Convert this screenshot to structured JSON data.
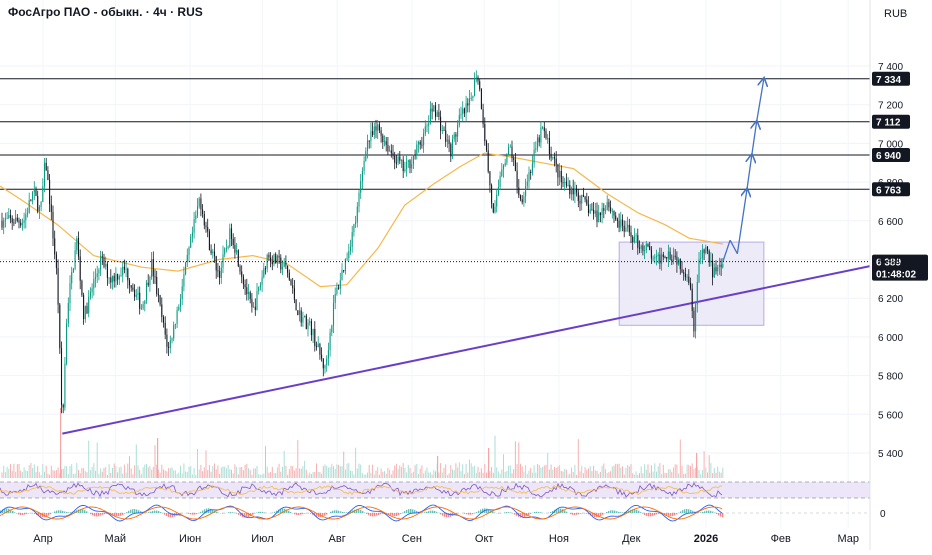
{
  "chart_data": {
    "type": "candlestick",
    "title": "ФосАгро ПАО - обыкн. · 4ч · RUS",
    "currency": "RUB",
    "y_ticks": [
      5400,
      5600,
      5800,
      6000,
      6200,
      6400,
      6600,
      6800,
      7000,
      7200,
      7400
    ],
    "ylim": [
      5260,
      7530
    ],
    "x_labels": [
      "Апр",
      "Май",
      "Июн",
      "Июл",
      "Авг",
      "Сен",
      "Окт",
      "Ноя",
      "Дек",
      "2026",
      "Фев",
      "Мар"
    ],
    "horizontal_levels": [
      {
        "value": 7334,
        "label": "7 334"
      },
      {
        "value": 7112,
        "label": "7 112"
      },
      {
        "value": 6940,
        "label": "6 940"
      },
      {
        "value": 6763,
        "label": "6 763"
      }
    ],
    "current_price": {
      "value": 6389,
      "label": "6 389",
      "countdown": "01:48:02"
    },
    "price_path": [
      [
        "2025-03-24",
        6600
      ],
      [
        "2025-03-28",
        6750
      ],
      [
        "2025-03-31",
        6640
      ],
      [
        "2025-04-02",
        6920
      ],
      [
        "2025-04-04",
        6680
      ],
      [
        "2025-04-07",
        6280
      ],
      [
        "2025-04-09",
        5520
      ],
      [
        "2025-04-11",
        6150
      ],
      [
        "2025-04-15",
        6500
      ],
      [
        "2025-04-18",
        6100
      ],
      [
        "2025-04-22",
        6280
      ],
      [
        "2025-04-25",
        6400
      ],
      [
        "2025-04-29",
        6300
      ],
      [
        "2025-05-05",
        6350
      ],
      [
        "2025-05-12",
        6150
      ],
      [
        "2025-05-16",
        6380
      ],
      [
        "2025-05-21",
        6050
      ],
      [
        "2025-05-23",
        5930
      ],
      [
        "2025-05-27",
        6150
      ],
      [
        "2025-06-01",
        6470
      ],
      [
        "2025-06-05",
        6720
      ],
      [
        "2025-06-09",
        6480
      ],
      [
        "2025-06-13",
        6320
      ],
      [
        "2025-06-18",
        6550
      ],
      [
        "2025-06-23",
        6300
      ],
      [
        "2025-06-27",
        6120
      ],
      [
        "2025-07-03",
        6420
      ],
      [
        "2025-07-08",
        6380
      ],
      [
        "2025-07-11",
        6350
      ],
      [
        "2025-07-16",
        6120
      ],
      [
        "2025-07-21",
        6050
      ],
      [
        "2025-07-25",
        5900
      ],
      [
        "2025-07-27",
        5830
      ],
      [
        "2025-07-31",
        6200
      ],
      [
        "2025-08-05",
        6420
      ],
      [
        "2025-08-09",
        6620
      ],
      [
        "2025-08-13",
        7000
      ],
      [
        "2025-08-18",
        7080
      ],
      [
        "2025-08-23",
        6960
      ],
      [
        "2025-08-29",
        6860
      ],
      [
        "2025-09-02",
        6940
      ],
      [
        "2025-09-06",
        7040
      ],
      [
        "2025-09-10",
        7200
      ],
      [
        "2025-09-14",
        7060
      ],
      [
        "2025-09-17",
        6960
      ],
      [
        "2025-09-21",
        7130
      ],
      [
        "2025-09-25",
        7200
      ],
      [
        "2025-09-28",
        7380
      ],
      [
        "2025-09-30",
        7190
      ],
      [
        "2025-10-03",
        6820
      ],
      [
        "2025-10-05",
        6600
      ],
      [
        "2025-10-08",
        6880
      ],
      [
        "2025-10-12",
        6980
      ],
      [
        "2025-10-16",
        6700
      ],
      [
        "2025-10-20",
        6860
      ],
      [
        "2025-10-25",
        7080
      ],
      [
        "2025-10-29",
        6940
      ],
      [
        "2025-11-02",
        6800
      ],
      [
        "2025-11-07",
        6760
      ],
      [
        "2025-11-12",
        6680
      ],
      [
        "2025-11-17",
        6620
      ],
      [
        "2025-11-21",
        6700
      ],
      [
        "2025-11-26",
        6580
      ],
      [
        "2025-12-01",
        6530
      ],
      [
        "2025-12-04",
        6480
      ],
      [
        "2025-12-08",
        6450
      ],
      [
        "2025-12-11",
        6380
      ],
      [
        "2025-12-15",
        6440
      ],
      [
        "2025-12-19",
        6420
      ],
      [
        "2025-12-23",
        6350
      ],
      [
        "2025-12-25",
        6300
      ],
      [
        "2025-12-27",
        6060
      ],
      [
        "2025-12-29",
        6380
      ],
      [
        "2026-01-01",
        6460
      ],
      [
        "2026-01-04",
        6320
      ],
      [
        "2026-01-06",
        6400
      ],
      [
        "2026-01-08",
        6389
      ]
    ],
    "ma_path": [
      [
        "2025-03-24",
        6700
      ],
      [
        "2025-04-07",
        6580
      ],
      [
        "2025-04-22",
        6420
      ],
      [
        "2025-05-12",
        6360
      ],
      [
        "2025-05-27",
        6340
      ],
      [
        "2025-06-13",
        6400
      ],
      [
        "2025-06-27",
        6420
      ],
      [
        "2025-07-11",
        6380
      ],
      [
        "2025-07-25",
        6260
      ],
      [
        "2025-08-05",
        6270
      ],
      [
        "2025-08-18",
        6460
      ],
      [
        "2025-08-29",
        6680
      ],
      [
        "2025-09-10",
        6790
      ],
      [
        "2025-09-21",
        6880
      ],
      [
        "2025-10-01",
        6950
      ],
      [
        "2025-10-12",
        6930
      ],
      [
        "2025-10-25",
        6900
      ],
      [
        "2025-11-07",
        6870
      ],
      [
        "2025-11-21",
        6740
      ],
      [
        "2025-12-04",
        6640
      ],
      [
        "2025-12-15",
        6580
      ],
      [
        "2025-12-25",
        6510
      ],
      [
        "2026-01-08",
        6480
      ]
    ],
    "trendline": {
      "start": [
        "2025-04-09",
        5500
      ],
      "end": [
        "2026-03-31",
        6420
      ]
    },
    "range_box": {
      "x_start": "2025-11-26",
      "x_end": "2026-01-25",
      "y_low": 6060,
      "y_high": 6490
    },
    "projection_arrows": [
      [
        [
          "2026-01-08",
          6389
        ],
        [
          "2026-01-11",
          6500
        ]
      ],
      [
        [
          "2026-01-11",
          6500
        ],
        [
          "2026-01-14",
          6430
        ]
      ],
      [
        [
          "2026-01-14",
          6430
        ],
        [
          "2026-01-18",
          6763
        ]
      ],
      [
        [
          "2026-01-18",
          6763
        ],
        [
          "2026-01-20",
          6940
        ]
      ],
      [
        [
          "2026-01-20",
          6940
        ],
        [
          "2026-01-22",
          7112
        ]
      ],
      [
        [
          "2026-01-22",
          7112
        ],
        [
          "2026-01-25",
          7334
        ]
      ]
    ],
    "indicator_zero_label": "0",
    "colors": {
      "up": "#089981",
      "down": "#131722",
      "ma": "#f7b84b",
      "trendline": "#6a3fc8",
      "arrow": "#4472c4",
      "range_fill": "#e7e2f7",
      "range_stroke": "#b8abe6",
      "level": "#131722",
      "volume": "#f4a5a5",
      "rsi_band": "#ece6f8",
      "rsi_line": "#7e57c2",
      "macd_line": "#2962ff",
      "signal_line": "#ff6d00"
    }
  }
}
